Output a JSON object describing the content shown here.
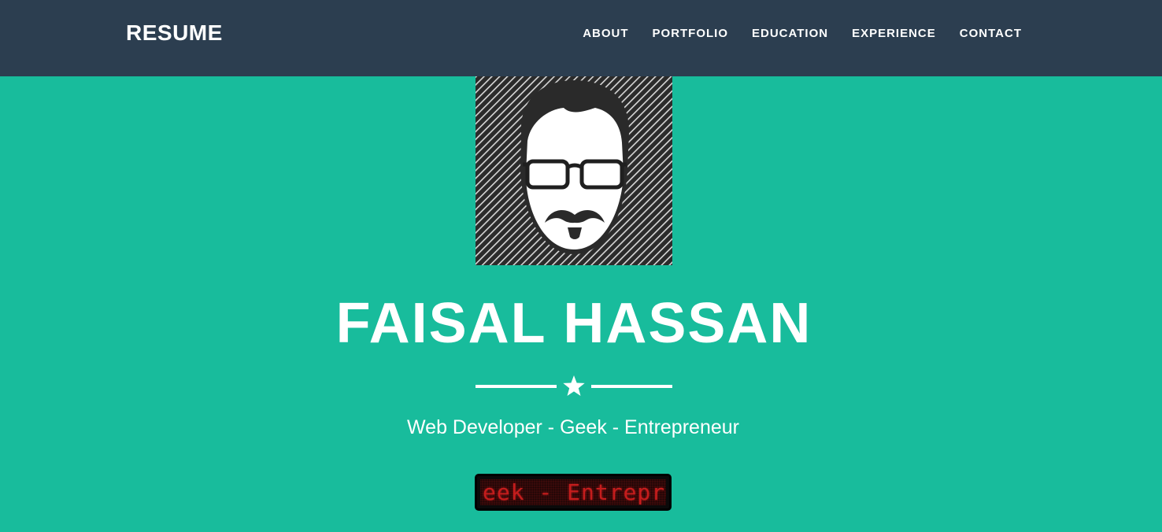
{
  "navbar": {
    "brand": "RESUME",
    "links": [
      "ABOUT",
      "PORTFOLIO",
      "EDUCATION",
      "EXPERIENCE",
      "CONTACT"
    ]
  },
  "header": {
    "name": "FAISAL HASSAN",
    "tagline": "Web Developer - Geek - Entrepreneur",
    "led_marquee_text": "eek - Entrepre"
  },
  "colors": {
    "navbar_bg": "#2c3e50",
    "page_bg": "#18bc9c",
    "text": "#ffffff",
    "led_text": "#d62020"
  },
  "icons": [
    "star-icon",
    "avatar-portrait"
  ]
}
